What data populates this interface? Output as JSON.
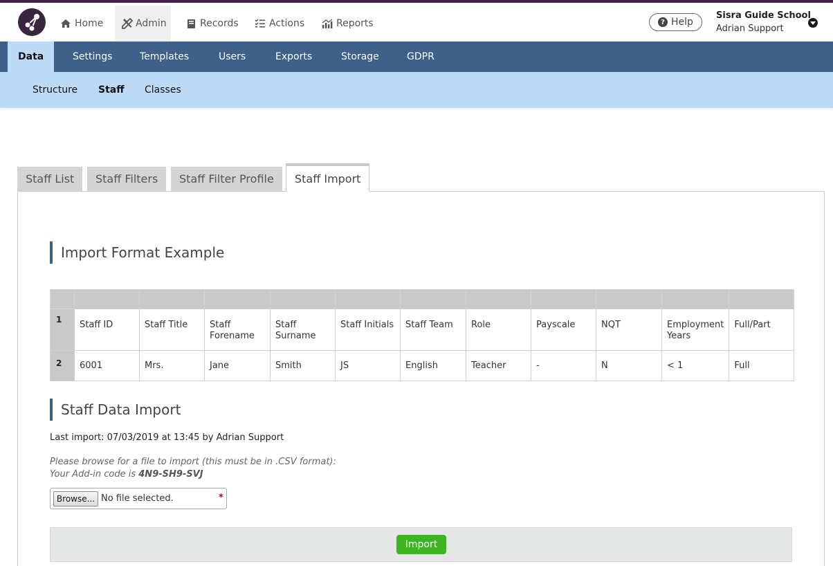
{
  "topnav": {
    "items": [
      {
        "label": "Home",
        "icon": "home-icon"
      },
      {
        "label": "Admin",
        "icon": "tools-icon"
      },
      {
        "label": "Records",
        "icon": "book-icon"
      },
      {
        "label": "Actions",
        "icon": "checklist-icon"
      },
      {
        "label": "Reports",
        "icon": "chart-icon"
      }
    ],
    "active": "Admin",
    "help_label": "Help",
    "school": "Sisra Guide School",
    "user": "Adrian Support"
  },
  "mainnav": {
    "tabs": [
      "Data",
      "Settings",
      "Templates",
      "Users",
      "Exports",
      "Storage",
      "GDPR"
    ],
    "active": "Data"
  },
  "subnav": {
    "items": [
      "Structure",
      "Staff",
      "Classes"
    ],
    "active": "Staff"
  },
  "page_tabs": {
    "items": [
      "Staff List",
      "Staff Filters",
      "Staff Filter Profile",
      "Staff Import"
    ],
    "active": "Staff Import"
  },
  "example": {
    "title": "Import Format Example",
    "rows": [
      {
        "num": "1",
        "cells": [
          "Staff ID",
          "Staff Title",
          "Staff Forename",
          "Staff Surname",
          "Staff Initials",
          "Staff Team",
          "Role",
          "Payscale",
          "NQT",
          "Employment Years",
          "Full/Part"
        ]
      },
      {
        "num": "2",
        "cells": [
          "6001",
          "Mrs.",
          "Jane",
          "Smith",
          "JS",
          "English",
          "Teacher",
          "-",
          "N",
          "< 1",
          "Full"
        ]
      }
    ]
  },
  "import": {
    "title": "Staff Data Import",
    "last_import": "Last import: 07/03/2019 at 13:45 by Adrian Support",
    "hint_line1": "Please browse for a file to import (this must be in .CSV format):",
    "hint_line2_prefix": "Your Add-in code is ",
    "addin_code": "4N9-SH9-SVJ",
    "browse_label": "Browse...",
    "no_file": "No file selected.",
    "required_mark": "*",
    "import_button": "Import"
  },
  "colors": {
    "brand_dark": "#3d1f47",
    "nav_blue": "#3e6089",
    "light_blue": "#bcd9f5",
    "import_green": "#3cb521"
  }
}
